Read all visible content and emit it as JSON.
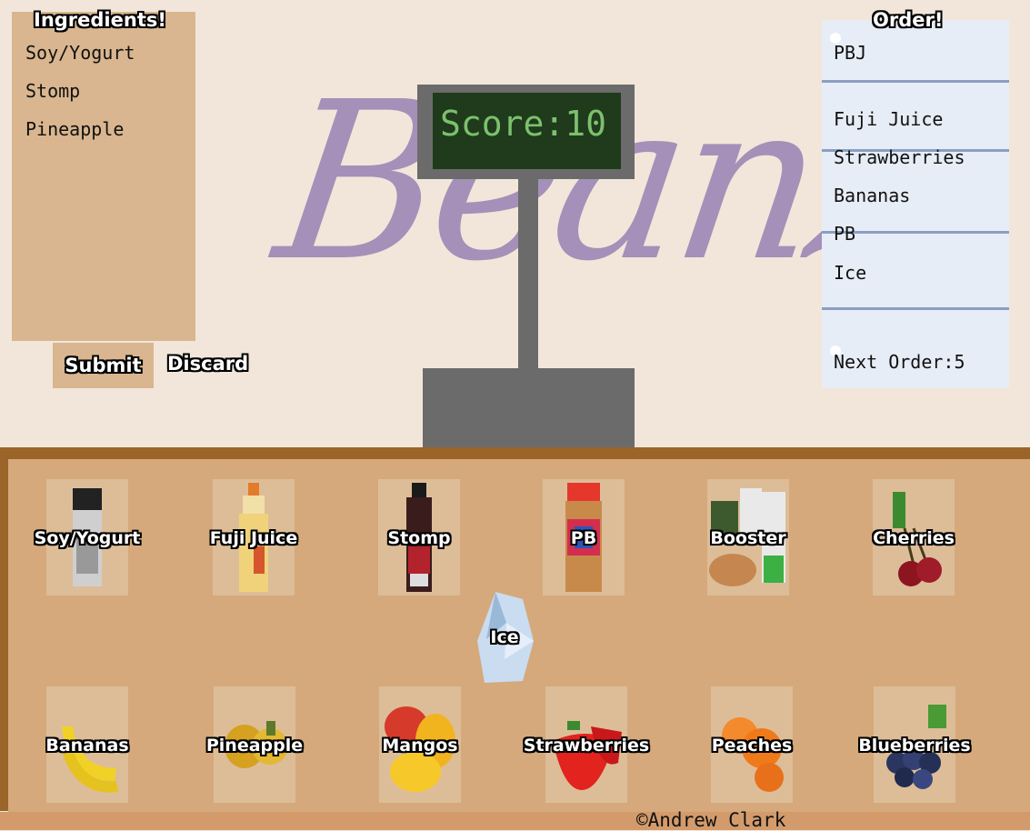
{
  "ingredients": {
    "title": "Ingredients!",
    "items": [
      "Soy/Yogurt",
      "Stomp",
      "Pineapple"
    ]
  },
  "controls": {
    "submit_label": "Submit",
    "discard_label": "Discard"
  },
  "logo": {
    "text": "Beanz"
  },
  "score": {
    "label": "Score:",
    "value": "10"
  },
  "order": {
    "title": "Order!",
    "name": "PBJ",
    "items": [
      "Fuji Juice",
      "Strawberries",
      "Bananas",
      "PB",
      "Ice"
    ],
    "next_label": "Next Order:",
    "next_value": "5"
  },
  "shelf": {
    "items": [
      {
        "label": "Soy/Yogurt",
        "icon": "yogurt-carton-icon"
      },
      {
        "label": "Fuji Juice",
        "icon": "juice-bottle-icon"
      },
      {
        "label": "Stomp",
        "icon": "syrup-bottle-icon"
      },
      {
        "label": "PB",
        "icon": "peanut-butter-jar-icon"
      },
      {
        "label": "Booster",
        "icon": "booster-supplement-icon"
      },
      {
        "label": "Cherries",
        "icon": "cherries-icon"
      },
      {
        "label": "Ice",
        "icon": "ice-icon"
      },
      {
        "label": "Bananas",
        "icon": "bananas-icon"
      },
      {
        "label": "Pineapple",
        "icon": "pineapple-icon"
      },
      {
        "label": "Mangos",
        "icon": "mangos-icon"
      },
      {
        "label": "Strawberries",
        "icon": "strawberries-icon"
      },
      {
        "label": "Peaches",
        "icon": "peaches-icon"
      },
      {
        "label": "Blueberries",
        "icon": "blueberries-icon"
      }
    ]
  },
  "footer": {
    "copyright": "©Andrew Clark"
  },
  "colors": {
    "background": "#f2e6da",
    "panel": "#d9b68f",
    "logo": "#a490b8",
    "score_text": "#7dc06e",
    "counter": "#d5a97b",
    "counter_frame": "#9b6428",
    "order_panel": "#e7edf6"
  }
}
